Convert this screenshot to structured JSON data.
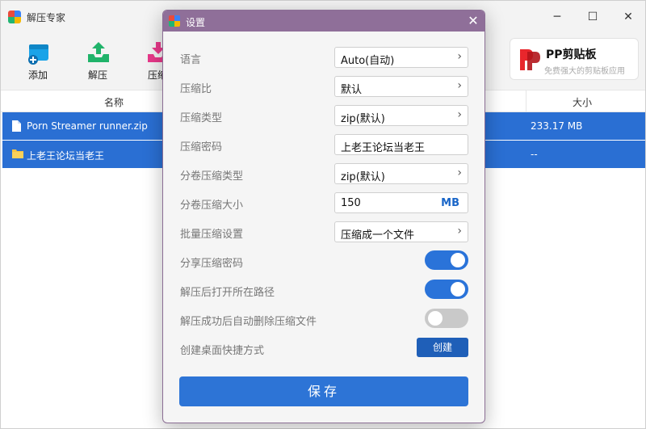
{
  "app": {
    "title": "解压专家",
    "window_controls": {
      "minimize": "─",
      "maximize": "☐",
      "close": "✕"
    }
  },
  "toolbar": {
    "items": [
      {
        "label": "添加",
        "icon": "add-archive-icon"
      },
      {
        "label": "解压",
        "icon": "extract-icon"
      },
      {
        "label": "压缩",
        "icon": "compress-icon"
      }
    ]
  },
  "promo": {
    "title": "PP剪贴板",
    "subtitle": "免费强大的剪贴板应用"
  },
  "file_list": {
    "columns": [
      "名称",
      "大小"
    ],
    "rows": [
      {
        "name": "Porn Streamer runner.zip",
        "size": "233.17 MB",
        "icon": "file-icon"
      },
      {
        "name": "上老王论坛当老王",
        "size": "--",
        "icon": "folder-icon"
      }
    ]
  },
  "settings_dialog": {
    "title": "设置",
    "close": "✕",
    "rows": [
      {
        "label": "语言",
        "value": "Auto(自动)"
      },
      {
        "label": "压缩比",
        "value": "默认"
      },
      {
        "label": "压缩类型",
        "value": "zip(默认)"
      },
      {
        "label": "压缩密码",
        "value": "上老王论坛当老王"
      },
      {
        "label": "分卷压缩类型",
        "value": "zip(默认)"
      },
      {
        "label": "分卷压缩大小",
        "value": "150",
        "unit": "MB"
      },
      {
        "label": "批量压缩设置",
        "value": "压缩成一个文件"
      },
      {
        "label": "分享压缩密码",
        "enabled": true
      },
      {
        "label": "解压后打开所在路径",
        "enabled": true
      },
      {
        "label": "解压成功后自动删除压缩文件",
        "enabled": false
      },
      {
        "label": "创建桌面快捷方式",
        "button": "创建"
      }
    ],
    "save_label": "保存"
  },
  "colors": {
    "selection": "#2a6fd3",
    "dialog_header": "#8f6f99",
    "accent": "#2d74d6",
    "toggle_off": "#c9c9c9"
  }
}
